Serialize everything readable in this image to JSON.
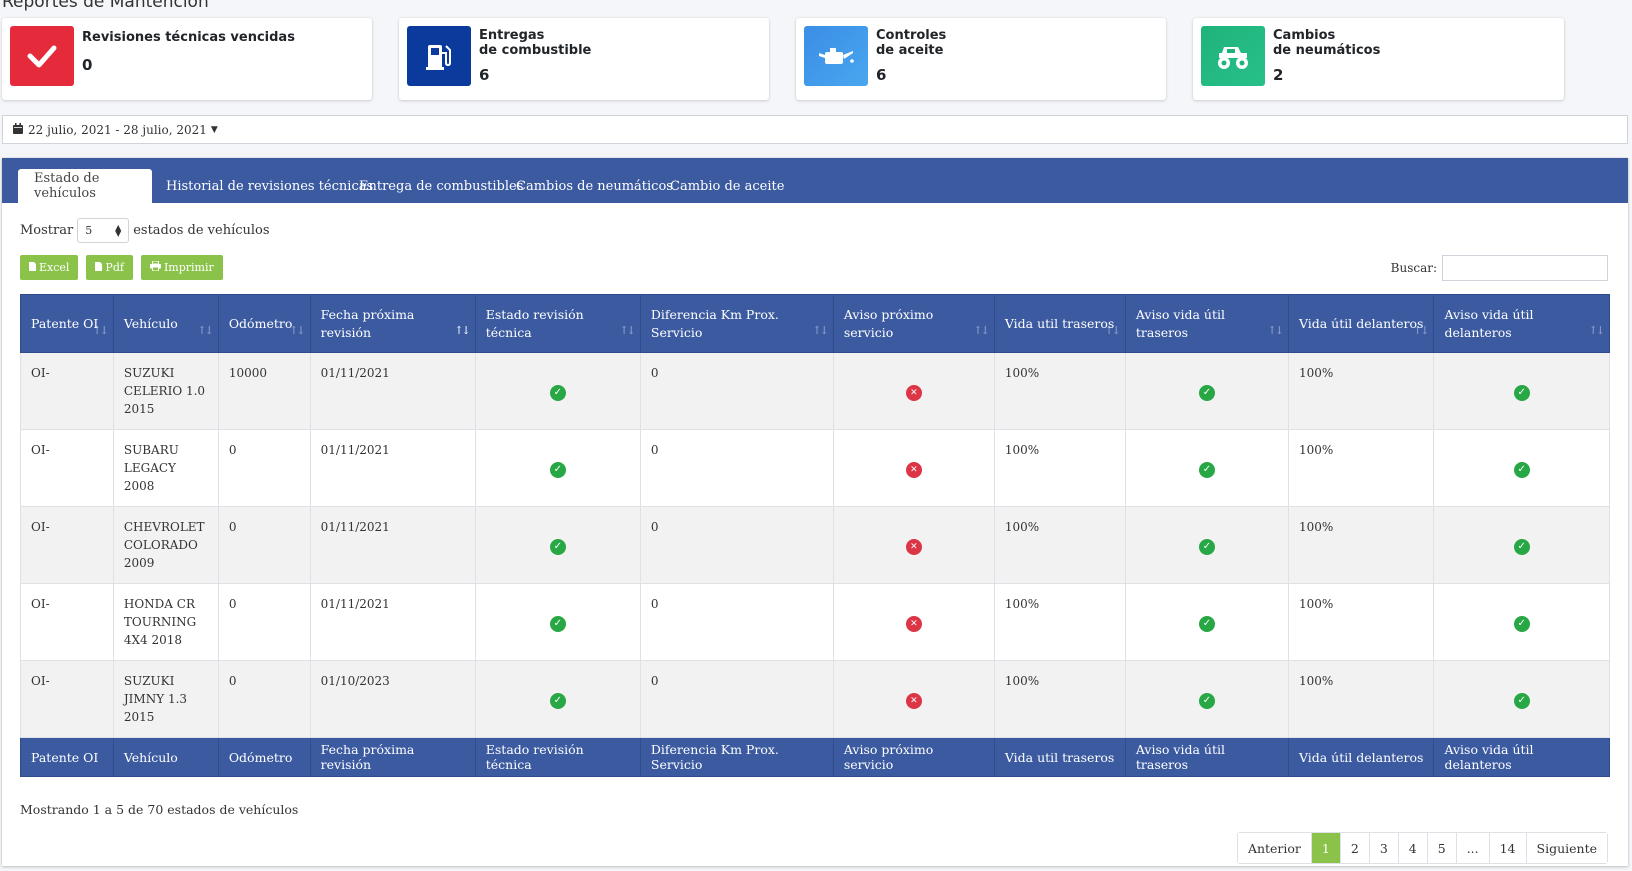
{
  "page": {
    "title": "Reportes de Mantención"
  },
  "stats": [
    {
      "label": "Revisiones técnicas vencidas",
      "value": "0",
      "icon": "check-icon",
      "color": "#dc3545"
    },
    {
      "label": "Entregas\nde combustible",
      "value": "6",
      "icon": "fuel-pump-icon",
      "color": "#0a3a9c"
    },
    {
      "label": "Controles\nde aceite",
      "value": "6",
      "icon": "oil-can-icon",
      "color": "#3a8ee6"
    },
    {
      "label": "Cambios\nde neumáticos",
      "value": "2",
      "icon": "monster-truck-icon",
      "color": "#1fb37a"
    }
  ],
  "daterange": {
    "value": "22 julio, 2021 - 28 julio, 2021"
  },
  "tabs": [
    {
      "label": "Estado de vehículos"
    },
    {
      "label": "Historial de revisiones técnicas"
    },
    {
      "label": "Entrega de combustibles"
    },
    {
      "label": "Cambios de neumáticos"
    },
    {
      "label": "Cambio de aceite"
    }
  ],
  "length": {
    "prefix": "Mostrar",
    "value": "5",
    "suffix": "estados de vehículos"
  },
  "buttons": {
    "excel": "Excel",
    "pdf": "Pdf",
    "print": "Imprimir"
  },
  "search": {
    "label": "Buscar:"
  },
  "table": {
    "headers": [
      "Patente OI",
      "Vehículo",
      "Odómetro",
      "Fecha próxima revisión",
      "Estado revisión técnica",
      "Diferencia Km Prox. Servicio",
      "Aviso próximo servicio",
      "Vida util traseros",
      "Aviso vida útil traseros",
      "Vida útil delanteros",
      "Aviso vida útil delanteros"
    ],
    "rows": [
      {
        "patente": "OI-",
        "vehiculo": "SUZUKI\nCELERIO 1.0\n2015",
        "odometro": "10000",
        "fecha": "01/11/2021",
        "estado": "ok",
        "diferencia": "0",
        "aviso": "bad",
        "traseros": "100%",
        "aviso_traseros": "ok",
        "delanteros": "100%",
        "aviso_delanteros": "ok"
      },
      {
        "patente": "OI-",
        "vehiculo": "SUBARU\nLEGACY\n2008",
        "odometro": "0",
        "fecha": "01/11/2021",
        "estado": "ok",
        "diferencia": "0",
        "aviso": "bad",
        "traseros": "100%",
        "aviso_traseros": "ok",
        "delanteros": "100%",
        "aviso_delanteros": "ok"
      },
      {
        "patente": "OI-",
        "vehiculo": "CHEVROLET\nCOLORADO\n2009",
        "odometro": "0",
        "fecha": "01/11/2021",
        "estado": "ok",
        "diferencia": "0",
        "aviso": "bad",
        "traseros": "100%",
        "aviso_traseros": "ok",
        "delanteros": "100%",
        "aviso_delanteros": "ok"
      },
      {
        "patente": "OI-",
        "vehiculo": "HONDA CR\nTOURNING\n4X4 2018",
        "odometro": "0",
        "fecha": "01/11/2021",
        "estado": "ok",
        "diferencia": "0",
        "aviso": "bad",
        "traseros": "100%",
        "aviso_traseros": "ok",
        "delanteros": "100%",
        "aviso_delanteros": "ok"
      },
      {
        "patente": "OI-",
        "vehiculo": "SUZUKI\nJIMNY 1.3\n2015",
        "odometro": "0",
        "fecha": "01/10/2023",
        "estado": "ok",
        "diferencia": "0",
        "aviso": "bad",
        "traseros": "100%",
        "aviso_traseros": "ok",
        "delanteros": "100%",
        "aviso_delanteros": "ok"
      }
    ]
  },
  "info": "Mostrando 1 a 5 de 70 estados de vehículos",
  "pagination": {
    "prev": "Anterior",
    "pages": [
      "1",
      "2",
      "3",
      "4",
      "5",
      "...",
      "14"
    ],
    "current": "1",
    "next": "Siguiente"
  }
}
